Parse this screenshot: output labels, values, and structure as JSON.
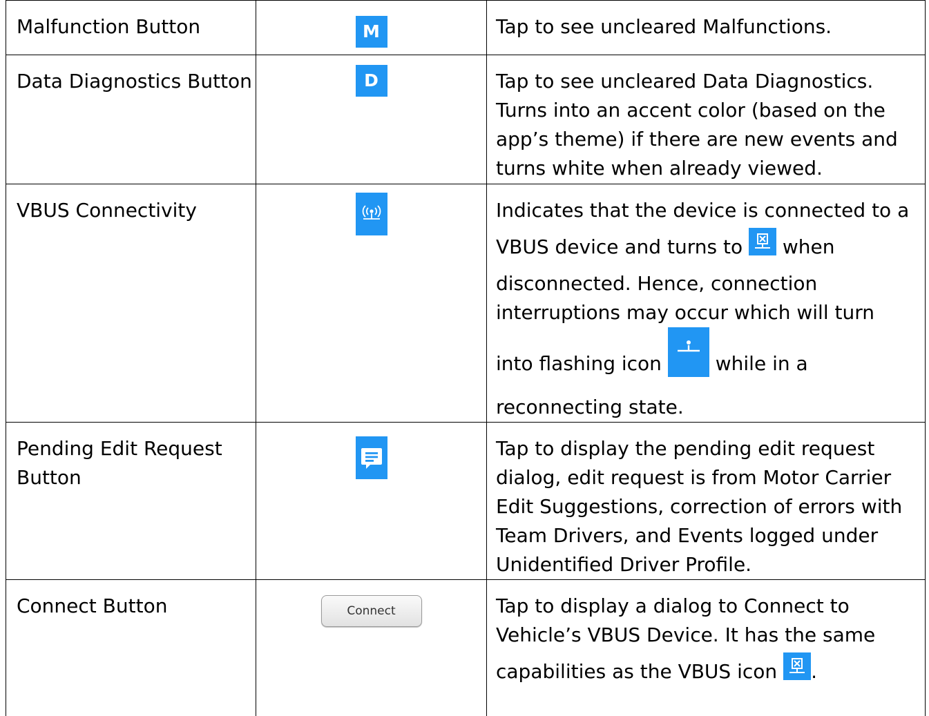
{
  "rows": [
    {
      "name": "Malfunction Button",
      "icon": "M",
      "icon_name": "malfunction-m-icon",
      "desc": "Tap to see uncleared Malfunctions."
    },
    {
      "name": "Data Diagnostics Button",
      "icon": "D",
      "icon_name": "data-diagnostics-d-icon",
      "desc": "Tap to see uncleared Data Diagnostics. Turns into an accent color (based on the app’s theme) if there are new events and turns white when already viewed."
    },
    {
      "name": "VBUS Connectivity",
      "icon_name": "vbus-connected-icon",
      "desc_1": "Indicates that the device is connected to a",
      "desc_2a": "VBUS device and turns to",
      "desc_2b": "when",
      "desc_3": "disconnected. Hence, connection interruptions may occur which will turn",
      "desc_4a": "into flashing icon",
      "desc_4b": "while in a",
      "desc_5": "reconnecting state."
    },
    {
      "name": "Pending Edit Request Button",
      "icon_name": "pending-edit-message-icon",
      "desc": "Tap to display the pending edit request dialog, edit request is from Motor Carrier Edit Suggestions, correction of errors with Team Drivers, and Events logged under Unidentified Driver Profile."
    },
    {
      "name": "Connect Button",
      "button_label": "Connect",
      "desc_1": "Tap to display a dialog to Connect to Vehicle’s VBUS Device. It has the same",
      "desc_2a": "capabilities as the VBUS icon",
      "desc_2b": "."
    }
  ],
  "colors": {
    "icon_blue": "#2196f3"
  }
}
